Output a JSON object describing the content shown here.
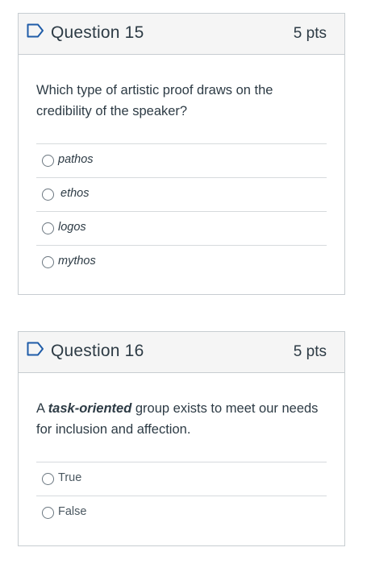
{
  "questions": [
    {
      "title": "Question 15",
      "points": "5 pts",
      "text": "Which type of artistic proof draws on the credibility of the speaker?",
      "answers": [
        "pathos",
        "ethos",
        "logos",
        "mythos"
      ]
    },
    {
      "title": "Question 16",
      "points": "5 pts",
      "text_prefix": "A ",
      "text_emphasis": "task-oriented",
      "text_suffix": " group exists to meet our needs for inclusion and affection.",
      "answers": [
        "True",
        "False"
      ]
    }
  ],
  "icons": {
    "flag": "bookmark-flag-icon"
  },
  "colors": {
    "flag": "#1f5ca8",
    "text": "#2d3b45",
    "border": "#c7cdd1",
    "header_bg": "#f5f5f5"
  }
}
